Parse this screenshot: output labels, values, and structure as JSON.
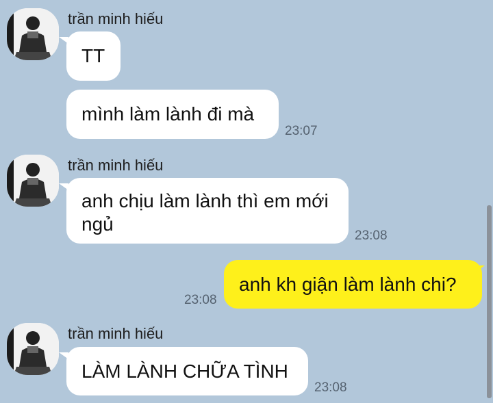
{
  "chat": {
    "background_color": "#b2c7da",
    "my_bubble_color": "#fef01b",
    "other_bubble_color": "#ffffff",
    "groups": [
      {
        "sender": "trần minh hiếu",
        "avatar_icon": "profile-photo-icon",
        "messages": [
          {
            "text": "TT",
            "time": ""
          },
          {
            "text": "mình làm lành đi mà",
            "time": "23:07"
          }
        ]
      },
      {
        "sender": "trần minh hiếu",
        "avatar_icon": "profile-photo-icon",
        "messages": [
          {
            "text": "anh chịu làm lành thì em mới ngủ",
            "time": "23:08"
          }
        ]
      },
      {
        "sender": "me",
        "messages": [
          {
            "text": "anh kh giận làm lành chi?",
            "time": "23:08"
          }
        ]
      },
      {
        "sender": "trần minh hiếu",
        "avatar_icon": "profile-photo-icon",
        "messages": [
          {
            "text": "LÀM LÀNH CHỮA TÌNH",
            "time": "23:08"
          }
        ]
      }
    ]
  }
}
